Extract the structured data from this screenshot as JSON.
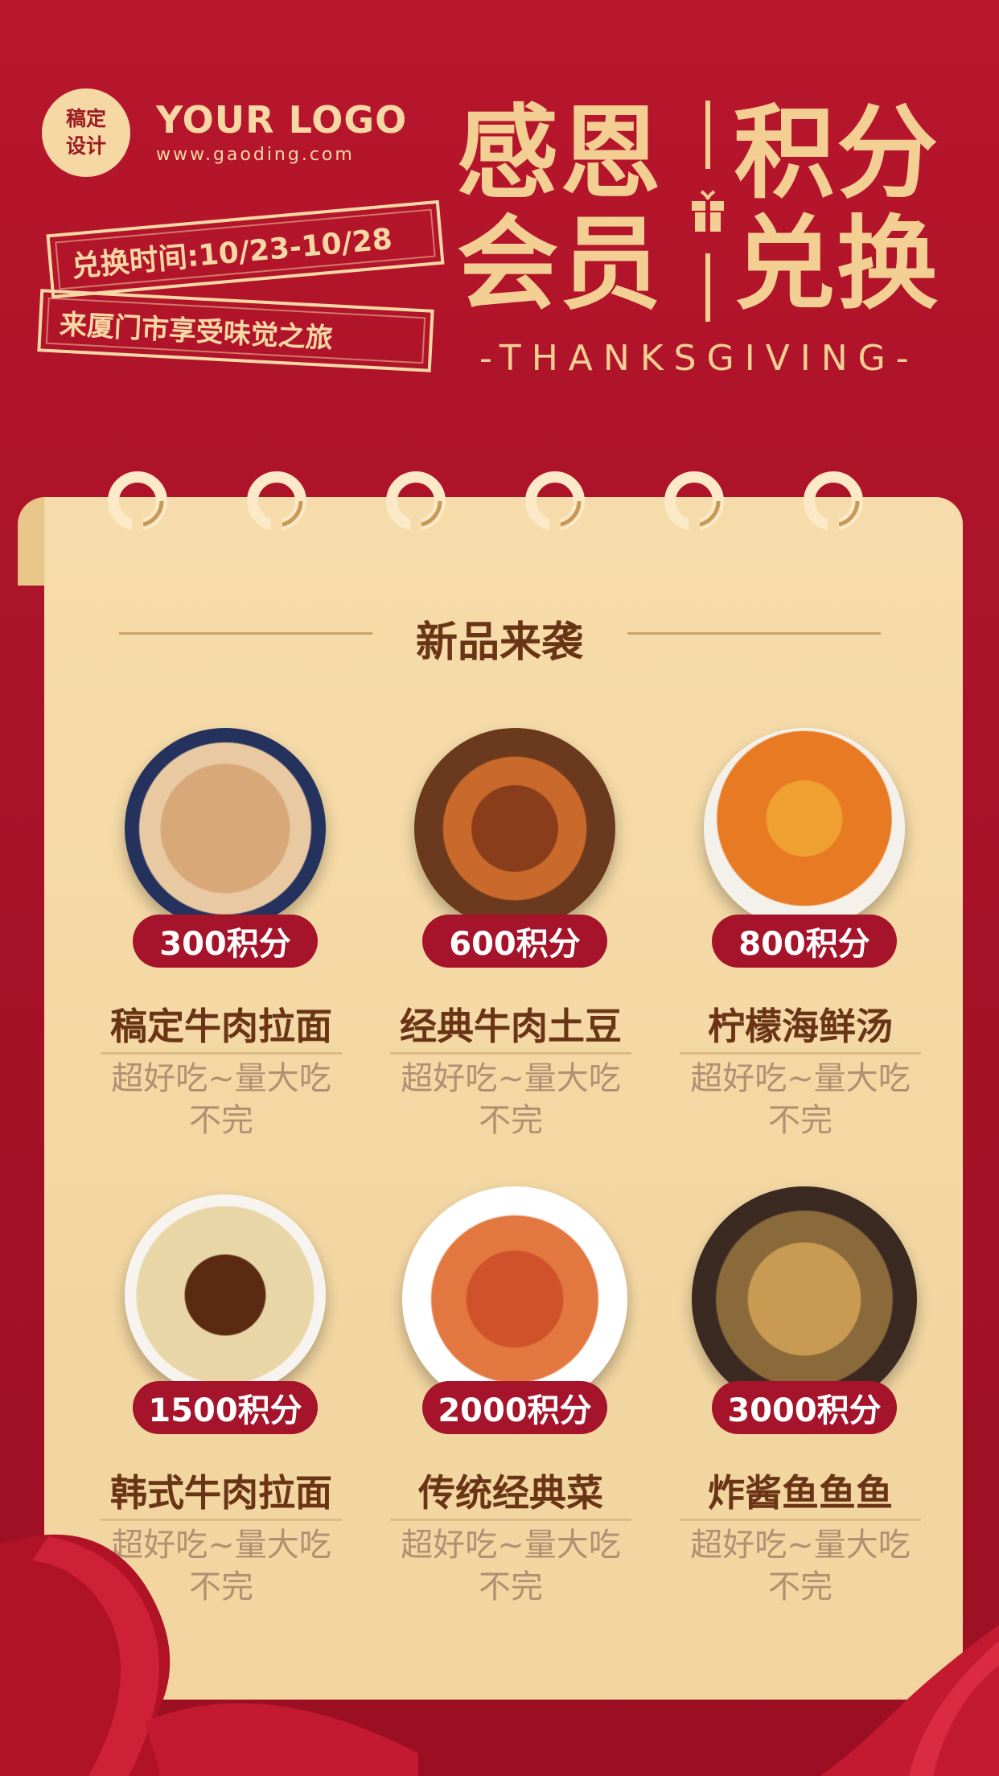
{
  "logo": {
    "badge_line1": "稿定",
    "badge_line2": "设计",
    "name": "YOUR LOGO",
    "url": "www.gaoding.com"
  },
  "tags": {
    "exchange_time": "兑换时间:10/23-10/28",
    "slogan": "来厦门市享受味觉之旅"
  },
  "title": {
    "left_line1": "感恩",
    "left_line2": "会员",
    "right_line1": "积分",
    "right_line2": "兑换",
    "subtitle": "-THANKSGIVING-"
  },
  "section": {
    "title": "新品来袭"
  },
  "dishes": [
    {
      "points": "300积分",
      "name": "稿定牛肉拉面",
      "desc": "超好吃~量大吃不完"
    },
    {
      "points": "600积分",
      "name": "经典牛肉土豆",
      "desc": "超好吃~量大吃不完"
    },
    {
      "points": "800积分",
      "name": "柠檬海鲜汤",
      "desc": "超好吃~量大吃不完"
    },
    {
      "points": "1500积分",
      "name": "韩式牛肉拉面",
      "desc": "超好吃~量大吃不完"
    },
    {
      "points": "2000积分",
      "name": "传统经典菜",
      "desc": "超好吃~量大吃不完"
    },
    {
      "points": "3000积分",
      "name": "炸酱鱼鱼鱼",
      "desc": "超好吃~量大吃不完"
    }
  ],
  "colors": {
    "background": "#b8162c",
    "gold": "#f3cf94",
    "panel": "#f6dcaa",
    "badge": "#a5142a",
    "brown_text": "#6a3517"
  }
}
